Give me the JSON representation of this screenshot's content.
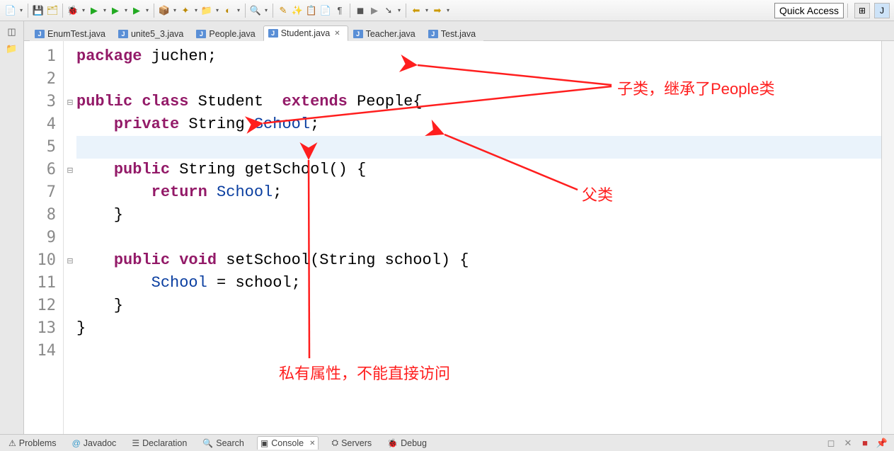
{
  "toolbar": {
    "quick_access": "Quick Access"
  },
  "tabs": [
    {
      "label": "EnumTest.java",
      "active": false
    },
    {
      "label": "unite5_3.java",
      "active": false
    },
    {
      "label": "People.java",
      "active": false
    },
    {
      "label": "Student.java",
      "active": true
    },
    {
      "label": "Teacher.java",
      "active": false
    },
    {
      "label": "Test.java",
      "active": false
    }
  ],
  "line_numbers": [
    "1",
    "2",
    "3",
    "4",
    "5",
    "6",
    "7",
    "8",
    "9",
    "10",
    "11",
    "12",
    "13",
    "14"
  ],
  "code": {
    "l1": {
      "kw1": "package",
      "rest": " juchen;"
    },
    "l3": {
      "kw1": "public",
      "kw2": "class",
      "name": " Student  ",
      "kw3": "extends",
      "rest": " People{"
    },
    "l4": {
      "indent": "    ",
      "kw": "private",
      "type": " String ",
      "field": "School",
      "rest": ";"
    },
    "l6": {
      "indent": "    ",
      "kw": "public",
      "type": " String ",
      "method": "getSchool() {"
    },
    "l7": {
      "indent": "        ",
      "kw": "return",
      "sp": " ",
      "field": "School",
      "rest": ";"
    },
    "l8": {
      "text": "    }"
    },
    "l10": {
      "indent": "    ",
      "kw1": "public",
      "kw2": " void",
      "rest": " setSchool(String school) {"
    },
    "l11": {
      "indent": "        ",
      "field": "School",
      "rest": " = school;"
    },
    "l12": {
      "text": "    }"
    },
    "l13": {
      "text": "}"
    }
  },
  "annotations": {
    "subclass": "子类，继承了People类",
    "parent": "父类",
    "private_attr": "私有属性，不能直接访问"
  },
  "views": [
    {
      "label": "Problems",
      "icon": "⚠"
    },
    {
      "label": "Javadoc",
      "icon": "@"
    },
    {
      "label": "Declaration",
      "icon": "☰"
    },
    {
      "label": "Search",
      "icon": "🔍"
    },
    {
      "label": "Console",
      "icon": "▣",
      "active": true
    },
    {
      "label": "Servers",
      "icon": "⛭"
    },
    {
      "label": "Debug",
      "icon": "🐞"
    }
  ]
}
